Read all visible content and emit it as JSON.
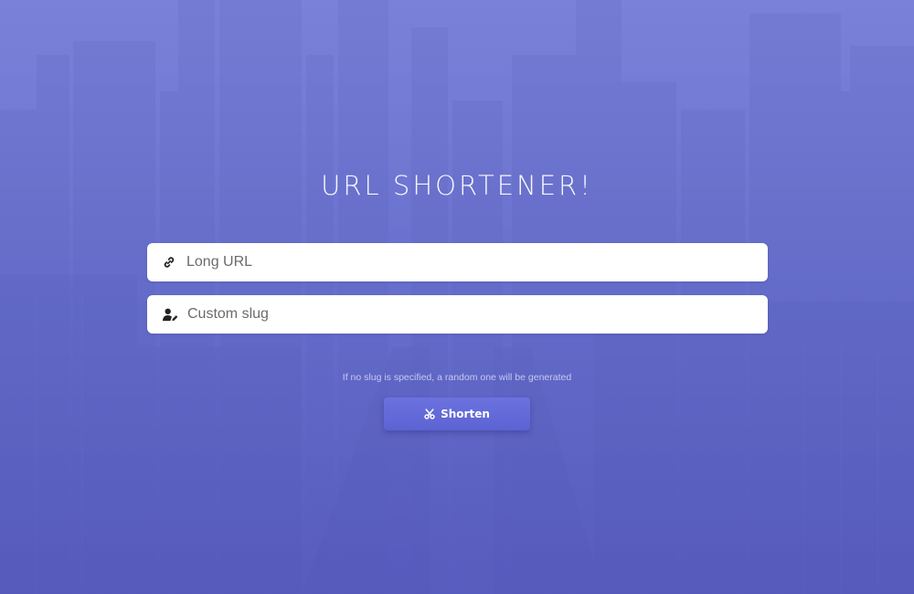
{
  "page": {
    "title": "URL SHORTENER!"
  },
  "form": {
    "long_url": {
      "placeholder": "Long URL",
      "value": "",
      "icon": "link-icon"
    },
    "custom_slug": {
      "placeholder": "Custom slug",
      "value": "",
      "icon": "user-edit-icon"
    },
    "hint": "If no slug is specified, a random one will be generated",
    "submit": {
      "label": "Shorten",
      "icon": "scissors-icon"
    }
  },
  "colors": {
    "background_top": "#7b84d8",
    "background_bottom": "#5a5fc0",
    "button": "#6067d8",
    "input_bg": "#ffffff",
    "title_text": "#ffffff"
  }
}
